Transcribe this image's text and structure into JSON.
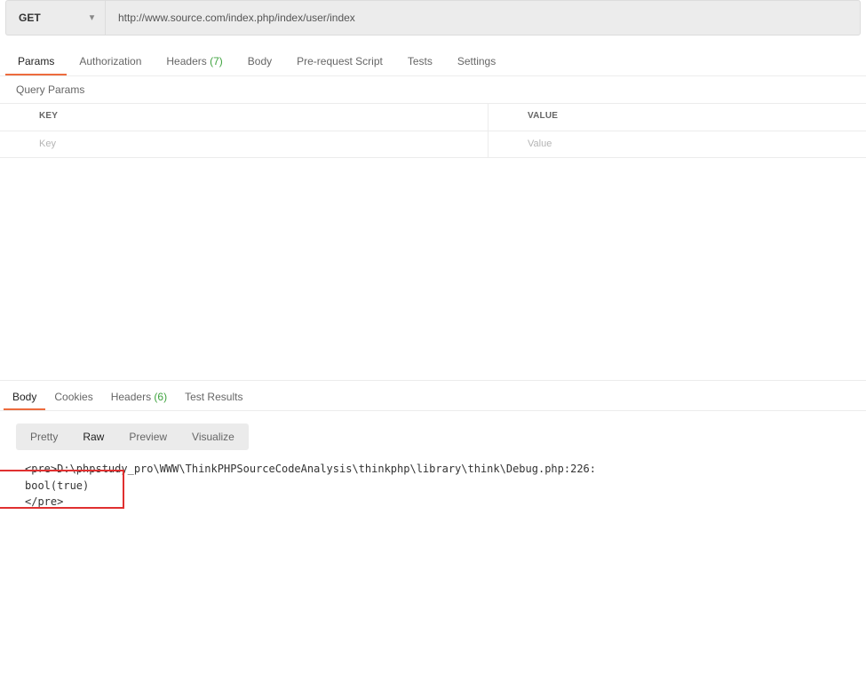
{
  "request": {
    "method": "GET",
    "url": "http://www.source.com/index.php/index/user/index",
    "tabs": {
      "params": "Params",
      "authorization": "Authorization",
      "headers": "Headers",
      "headers_count": "(7)",
      "body": "Body",
      "prerequest": "Pre-request Script",
      "tests": "Tests",
      "settings": "Settings"
    },
    "sub_section": "Query Params",
    "params_table": {
      "key_header": "KEY",
      "value_header": "VALUE",
      "key_placeholder": "Key",
      "value_placeholder": "Value"
    }
  },
  "response": {
    "tabs": {
      "body": "Body",
      "cookies": "Cookies",
      "headers": "Headers",
      "headers_count": "(6)",
      "test_results": "Test Results"
    },
    "view_modes": {
      "pretty": "Pretty",
      "raw": "Raw",
      "preview": "Preview",
      "visualize": "Visualize"
    },
    "body_lines": {
      "l1": "<pre>D:\\phpstudy_pro\\WWW\\ThinkPHPSourceCodeAnalysis\\thinkphp\\library\\think\\Debug.php:226:",
      "l2": "bool(true)",
      "l3": "</pre>"
    }
  }
}
